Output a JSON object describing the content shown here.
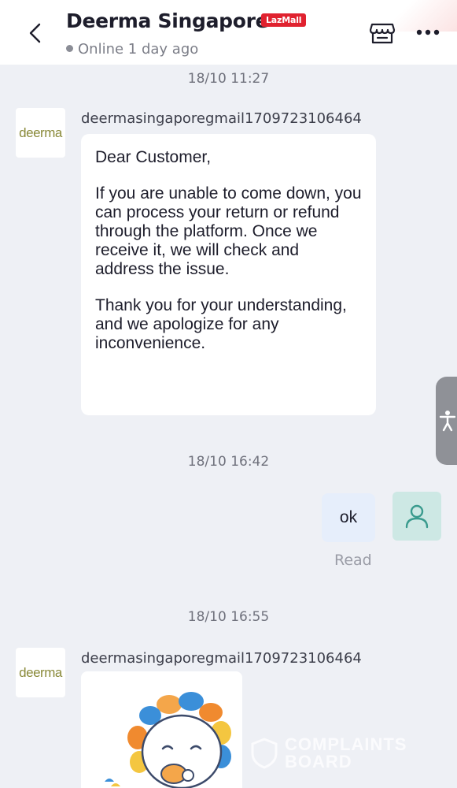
{
  "header": {
    "shop_name": "Deerma Singapore",
    "badge": "LazMall",
    "status": "Online 1 day ago"
  },
  "messages": [
    {
      "timestamp": "18/10 11:27",
      "sender": "deermasingaporegmail1709723106464",
      "avatar_text": "deerma",
      "paragraphs": [
        "Dear Customer,",
        "If you are unable to come down, you can process your return or refund through the platform. Once we receive it, we will check and address the issue.",
        "Thank you for your understanding, and we apologize for any inconvenience."
      ]
    },
    {
      "timestamp": "18/10 16:42",
      "text": "ok",
      "status": "Read"
    },
    {
      "timestamp": "18/10 16:55",
      "sender": "deermasingaporegmail1709723106464",
      "avatar_text": "deerma",
      "content": "sticker"
    }
  ],
  "watermark": {
    "line1": "COMPLAINTS",
    "line2": "BOARD"
  },
  "colors": {
    "background": "#eef0f5",
    "badge": "#e0222f",
    "my_bubble": "#e6eefb",
    "user_avatar": "#cde8e4",
    "user_avatar_icon": "#3a9b8e"
  },
  "icons": [
    "back-arrow-icon",
    "store-icon",
    "more-dots-icon",
    "accessibility-icon",
    "user-icon"
  ]
}
